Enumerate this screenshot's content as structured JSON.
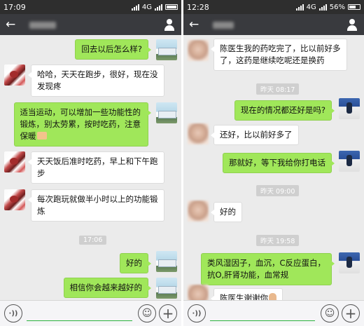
{
  "left": {
    "status": {
      "time": "17:09",
      "network": "4G"
    },
    "nav": {
      "back_label": "←"
    },
    "messages": [
      {
        "side": "right",
        "text": "回去以后怎么样?"
      },
      {
        "side": "left",
        "text": "哈哈，天天在跑步，很好，现在没\n发现疼"
      },
      {
        "side": "right",
        "text": "适当运动，可以增加一些功能性的\n锻炼，别太劳累，按时吃药，注意\n保暖"
      },
      {
        "side": "left",
        "text": "天天饭后准时吃药，早上和下午跑\n步"
      },
      {
        "side": "left",
        "text": "每次跑玩就做半小时以上的功能锻\n炼"
      },
      {
        "side": "right",
        "text": "好的"
      },
      {
        "side": "right",
        "text": "相信你会越来越好的"
      }
    ],
    "timestamp": "17:06",
    "input": {
      "voice_label": "·))"
    }
  },
  "right": {
    "status": {
      "time": "12:28",
      "network": "4G",
      "battery": "56%"
    },
    "nav": {
      "back_label": "←"
    },
    "messages": [
      {
        "side": "left",
        "text": "陈医生我的药吃完了，比以前好多\n了，这药是继续吃呢还是换药"
      },
      {
        "side": "right",
        "text": "现在的情况都还好是吗?"
      },
      {
        "side": "left",
        "text": "还好，比以前好多了"
      },
      {
        "side": "right",
        "text": "那就好，等下我给你打电话"
      },
      {
        "side": "left",
        "text": "好的"
      },
      {
        "side": "right",
        "text": "类风湿因子，血沉，C反应蛋白，\n抗O,肝肾功能，血常规"
      },
      {
        "side": "left",
        "text": "陈医生谢谢你"
      }
    ],
    "timestamps": [
      "昨天 08:17",
      "昨天 09:00",
      "昨天 19:58"
    ],
    "input": {
      "voice_label": "·))"
    }
  }
}
